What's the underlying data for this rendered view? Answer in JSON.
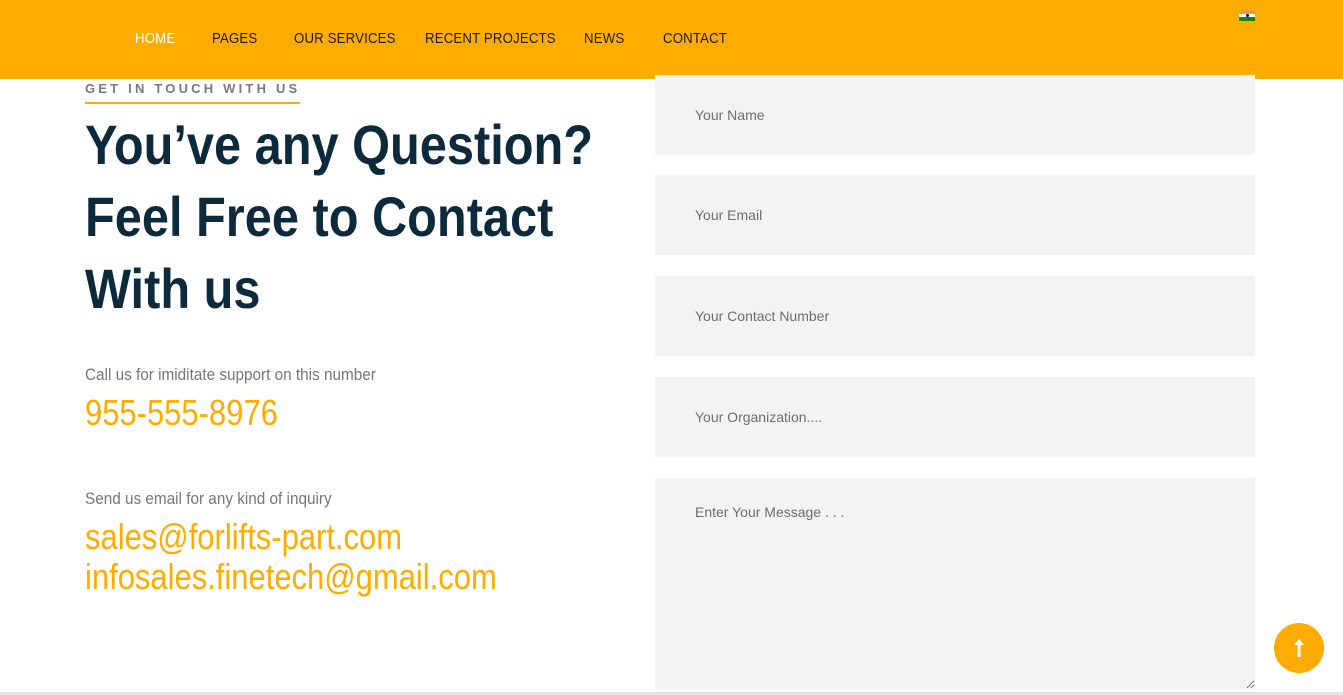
{
  "nav": {
    "items": [
      {
        "label": "HOME",
        "active": true
      },
      {
        "label": "PAGES",
        "active": false
      },
      {
        "label": "OUR SERVICES",
        "active": false
      },
      {
        "label": "RECENT PROJECTS",
        "active": false
      },
      {
        "label": "NEWS",
        "active": false
      },
      {
        "label": "CONTACT",
        "active": false
      }
    ],
    "language_icon": "india-flag-icon"
  },
  "contact": {
    "eyebrow": "GET IN TOUCH WITH US",
    "headline_line1": "You’ve any Question?",
    "headline_line2": "Feel Free to Contact",
    "headline_line3": "With us",
    "phone_label": "Call us for imiditate support on this number",
    "phone": "955-555-8976",
    "email_label": "Send us email for any kind of inquiry",
    "email_1": "sales@forlifts-part.com",
    "email_2": "infosales.finetech@gmail.com"
  },
  "form": {
    "name_placeholder": "Your Name",
    "email_placeholder": "Your Email",
    "phone_placeholder": "Your Contact Number",
    "org_placeholder": "Your Organization....",
    "message_placeholder": "Enter Your Message . . ."
  },
  "colors": {
    "accent": "#ffac00",
    "heading": "#0c2a3c",
    "field_bg": "#f3f3f3"
  },
  "scroll_top_icon": "arrow-up-icon"
}
